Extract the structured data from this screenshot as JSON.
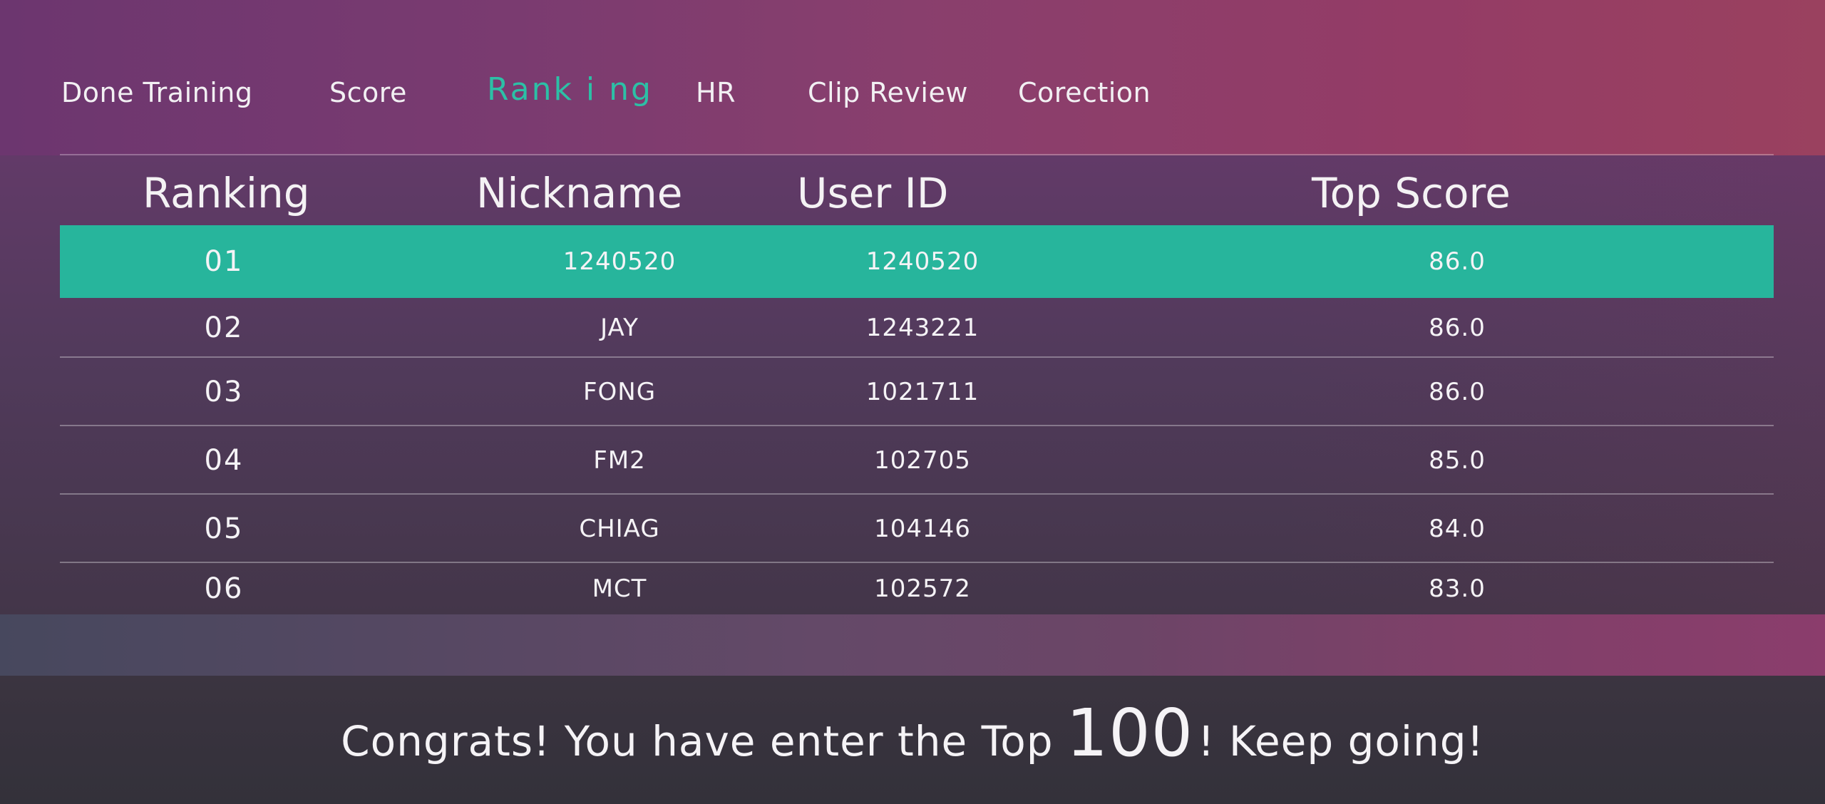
{
  "nav": {
    "items": [
      {
        "label": "Done Training",
        "active": false
      },
      {
        "label": "Score",
        "active": false
      },
      {
        "label": "Rank i ng",
        "active": true
      },
      {
        "label": "HR",
        "active": false
      },
      {
        "label": "Clip Review",
        "active": false
      },
      {
        "label": "Corection",
        "active": false
      }
    ]
  },
  "table": {
    "headers": {
      "ranking": "Ranking",
      "nickname": "Nickname",
      "user_id": "User ID",
      "top_score": "Top Score"
    },
    "rows": [
      {
        "rank": "01",
        "nickname": "1240520",
        "user_id": "1240520",
        "score": "86.0",
        "highlighted": true
      },
      {
        "rank": "02",
        "nickname": "JAY",
        "user_id": "1243221",
        "score": "86.0",
        "highlighted": false
      },
      {
        "rank": "03",
        "nickname": "FONG",
        "user_id": "1021711",
        "score": "86.0",
        "highlighted": false
      },
      {
        "rank": "04",
        "nickname": "FM2",
        "user_id": "102705",
        "score": "85.0",
        "highlighted": false
      },
      {
        "rank": "05",
        "nickname": "CHIAG",
        "user_id": "104146",
        "score": "84.0",
        "highlighted": false
      },
      {
        "rank": "06",
        "nickname": "MCT",
        "user_id": "102572",
        "score": "83.0",
        "highlighted": false
      }
    ]
  },
  "footer": {
    "before": "Congrats!  You have enter the Top",
    "number": "100",
    "after": "!  Keep going!"
  },
  "colors": {
    "accent": "#2cc0a6",
    "highlight_row": "#27b59c",
    "text": "#f5f3f6"
  }
}
